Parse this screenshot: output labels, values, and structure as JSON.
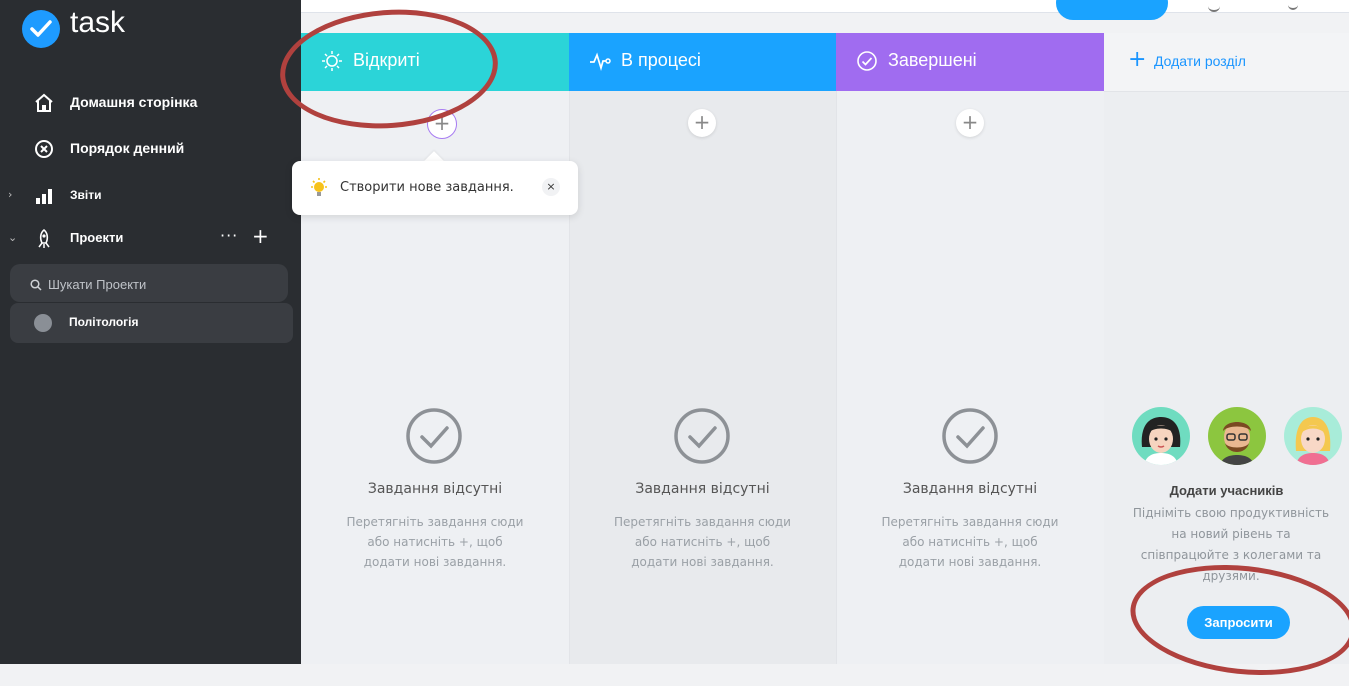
{
  "app": {
    "name": "task"
  },
  "sidebar": {
    "items": [
      {
        "label": "Домашня сторінка",
        "icon": "home-icon"
      },
      {
        "label": "Порядок денний",
        "icon": "agenda-icon"
      },
      {
        "label": "Звіти",
        "icon": "bar-chart-icon"
      },
      {
        "label": "Проекти",
        "icon": "rocket-icon"
      }
    ],
    "projects_more": "···",
    "projects_add": "+",
    "search_placeholder": "Шукати Проекти",
    "project": {
      "label": "Політологія"
    }
  },
  "columns": [
    {
      "title": "Відкриті",
      "color": "#2bd4d8",
      "icon": "sun-icon"
    },
    {
      "title": "В процесі",
      "color": "#1aa3ff",
      "icon": "pulse-icon"
    },
    {
      "title": "Завершені",
      "color": "#a06cf0",
      "icon": "check-circle-icon"
    }
  ],
  "empty_state": {
    "title": "Завдання відсутні",
    "line1": "Перетягніть завдання сюди",
    "line2": "або натисніть +, щоб",
    "line3": "додати нові завдання."
  },
  "add_button": "+",
  "add_section": {
    "plus": "+",
    "label": "Додати розділ"
  },
  "invite": {
    "title": "Додати учасників",
    "text": "Підніміть свою продуктивність на новий рівень та співпрацюйте з колегами та друзями.",
    "button": "Запросити"
  },
  "tooltip": {
    "text": "Створити нове завдання.",
    "close": "×"
  },
  "colors": {
    "sidebar": "#2a2d31",
    "accent": "#1aa3ff",
    "annotation": "#b0413e"
  }
}
